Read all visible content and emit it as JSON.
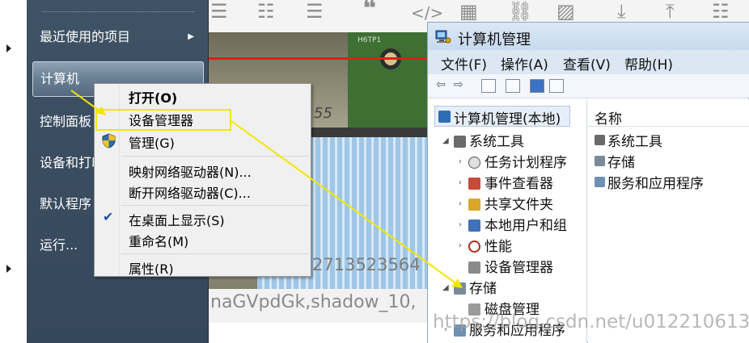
{
  "start_menu": {
    "items": [
      {
        "label": "最近使用的项目",
        "has_submenu": true
      },
      {
        "label": "计算机",
        "selected": true
      },
      {
        "label": "控制面板"
      },
      {
        "label": "设备和打印机"
      },
      {
        "label": "默认程序"
      },
      {
        "label": "运行..."
      }
    ]
  },
  "context_menu": {
    "items": [
      {
        "label": "打开(O)",
        "bold": true
      },
      {
        "label": "设备管理器",
        "highlighted": true
      },
      {
        "label": "管理(G)",
        "icon": "shield-icon"
      },
      {
        "label": "映射网络驱动器(N)..."
      },
      {
        "label": "断开网络驱动器(C)..."
      },
      {
        "label": "在桌面上显示(S)",
        "checked": true
      },
      {
        "label": "重命名(M)"
      },
      {
        "label": "属性(R)"
      }
    ]
  },
  "window": {
    "title": "计算机管理",
    "menubar": [
      "文件(F)",
      "操作(A)",
      "查看(V)",
      "帮助(H)"
    ],
    "tree": {
      "root": "计算机管理(本地)",
      "system_tools": "系统工具",
      "children": [
        "任务计划程序",
        "事件查看器",
        "共享文件夹",
        "本地用户和组",
        "性能",
        "设备管理器"
      ],
      "storage": "存储",
      "storage_children": [
        "磁盘管理"
      ],
      "services": "服务和应用程序"
    },
    "list": {
      "column": "名称",
      "items": [
        "系统工具",
        "存储",
        "服务和应用程序"
      ]
    }
  },
  "background": {
    "photo_number": "2713523564",
    "photo_watermark": "naGVpdGk,shadow_10,",
    "photo_hand": "55",
    "photo_pcb": "H6TP1"
  },
  "watermark": "https://blog.csdn.net/u012210613",
  "colors": {
    "start_menu_bg": "#3a4c5f",
    "highlight": "#f2e600",
    "photo_red_line": "#e31b1b"
  }
}
